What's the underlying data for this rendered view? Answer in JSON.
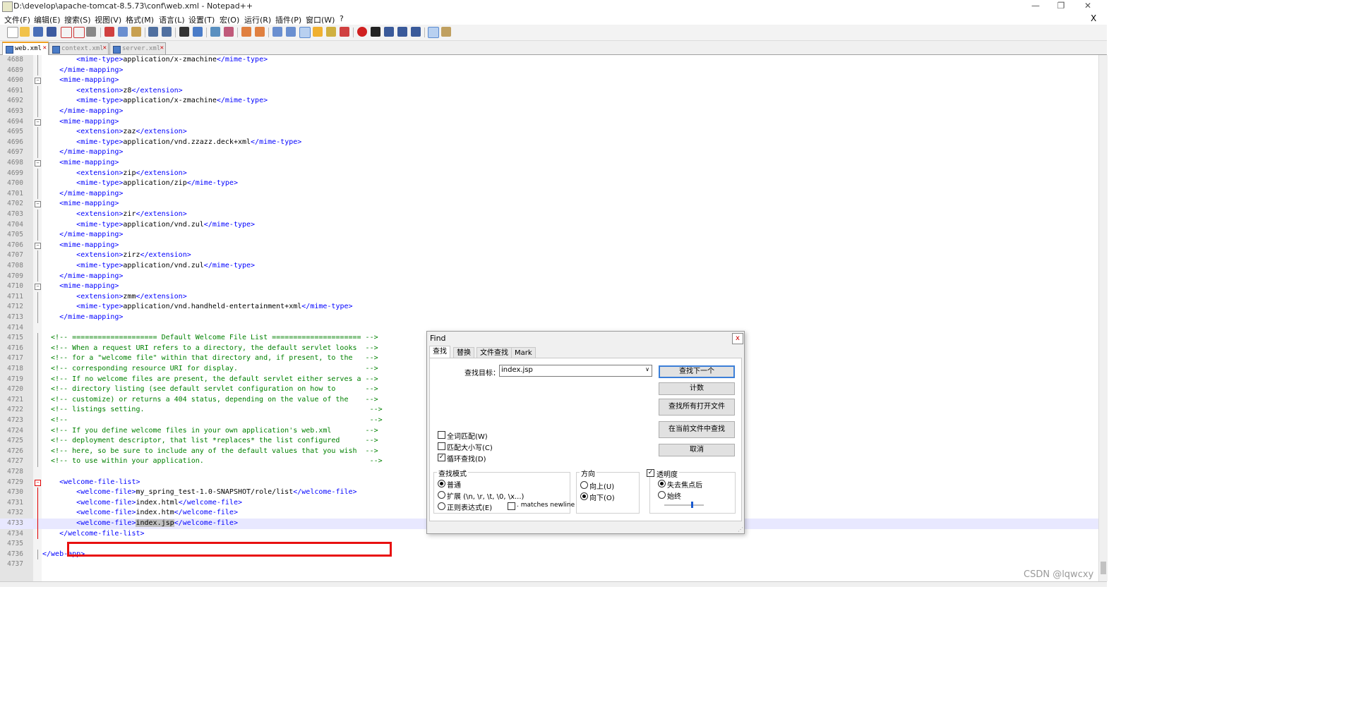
{
  "window": {
    "title": "D:\\develop\\apache-tomcat-8.5.73\\conf\\web.xml - Notepad++",
    "minimize": "—",
    "maximize": "❐",
    "close": "✕",
    "doc_close": "X"
  },
  "menu": [
    "文件(F)",
    "编辑(E)",
    "搜索(S)",
    "视图(V)",
    "格式(M)",
    "语言(L)",
    "设置(T)",
    "宏(O)",
    "运行(R)",
    "插件(P)",
    "窗口(W)",
    "?"
  ],
  "tabs": [
    {
      "label": "web.xml",
      "active": true
    },
    {
      "label": "context.xml",
      "active": false
    },
    {
      "label": "server.xml",
      "active": false
    }
  ],
  "lines": [
    {
      "n": "4688",
      "t": "        <mime-type>application/x-zmachine</mime-type>"
    },
    {
      "n": "4689",
      "t": "    </mime-mapping>"
    },
    {
      "n": "4690",
      "t": "    <mime-mapping>"
    },
    {
      "n": "4691",
      "t": "        <extension>z8</extension>"
    },
    {
      "n": "4692",
      "t": "        <mime-type>application/x-zmachine</mime-type>"
    },
    {
      "n": "4693",
      "t": "    </mime-mapping>"
    },
    {
      "n": "4694",
      "t": "    <mime-mapping>"
    },
    {
      "n": "4695",
      "t": "        <extension>zaz</extension>"
    },
    {
      "n": "4696",
      "t": "        <mime-type>application/vnd.zzazz.deck+xml</mime-type>"
    },
    {
      "n": "4697",
      "t": "    </mime-mapping>"
    },
    {
      "n": "4698",
      "t": "    <mime-mapping>"
    },
    {
      "n": "4699",
      "t": "        <extension>zip</extension>"
    },
    {
      "n": "4700",
      "t": "        <mime-type>application/zip</mime-type>"
    },
    {
      "n": "4701",
      "t": "    </mime-mapping>"
    },
    {
      "n": "4702",
      "t": "    <mime-mapping>"
    },
    {
      "n": "4703",
      "t": "        <extension>zir</extension>"
    },
    {
      "n": "4704",
      "t": "        <mime-type>application/vnd.zul</mime-type>"
    },
    {
      "n": "4705",
      "t": "    </mime-mapping>"
    },
    {
      "n": "4706",
      "t": "    <mime-mapping>"
    },
    {
      "n": "4707",
      "t": "        <extension>zirz</extension>"
    },
    {
      "n": "4708",
      "t": "        <mime-type>application/vnd.zul</mime-type>"
    },
    {
      "n": "4709",
      "t": "    </mime-mapping>"
    },
    {
      "n": "4710",
      "t": "    <mime-mapping>"
    },
    {
      "n": "4711",
      "t": "        <extension>zmm</extension>"
    },
    {
      "n": "4712",
      "t": "        <mime-type>application/vnd.handheld-entertainment+xml</mime-type>"
    },
    {
      "n": "4713",
      "t": "    </mime-mapping>"
    },
    {
      "n": "4714",
      "t": ""
    },
    {
      "n": "4715",
      "t": "  <!-- ==================== Default Welcome File List ===================== -->"
    },
    {
      "n": "4716",
      "t": "  <!-- When a request URI refers to a directory, the default servlet looks  -->"
    },
    {
      "n": "4717",
      "t": "  <!-- for a \"welcome file\" within that directory and, if present, to the   -->"
    },
    {
      "n": "4718",
      "t": "  <!-- corresponding resource URI for display.                              -->"
    },
    {
      "n": "4719",
      "t": "  <!-- If no welcome files are present, the default servlet either serves a -->"
    },
    {
      "n": "4720",
      "t": "  <!-- directory listing (see default servlet configuration on how to       -->"
    },
    {
      "n": "4721",
      "t": "  <!-- customize) or returns a 404 status, depending on the value of the    -->"
    },
    {
      "n": "4722",
      "t": "  <!-- listings setting.                                                     -->"
    },
    {
      "n": "4723",
      "t": "  <!--                                                                       -->"
    },
    {
      "n": "4724",
      "t": "  <!-- If you define welcome files in your own application's web.xml        -->"
    },
    {
      "n": "4725",
      "t": "  <!-- deployment descriptor, that list *replaces* the list configured      -->"
    },
    {
      "n": "4726",
      "t": "  <!-- here, so be sure to include any of the default values that you wish  -->"
    },
    {
      "n": "4727",
      "t": "  <!-- to use within your application.                                       -->"
    },
    {
      "n": "4728",
      "t": ""
    },
    {
      "n": "4729",
      "t": "    <welcome-file-list>"
    },
    {
      "n": "4730",
      "t": "        <welcome-file>my_spring_test-1.0-SNAPSHOT/role/list</welcome-file>"
    },
    {
      "n": "4731",
      "t": "        <welcome-file>index.html</welcome-file>"
    },
    {
      "n": "4732",
      "t": "        <welcome-file>index.htm</welcome-file>"
    },
    {
      "n": "4733",
      "t": "        <welcome-file>index.jsp</welcome-file>"
    },
    {
      "n": "4734",
      "t": "    </welcome-file-list>"
    },
    {
      "n": "4735",
      "t": ""
    },
    {
      "n": "4736",
      "t": "</web-app>"
    },
    {
      "n": "4737",
      "t": ""
    }
  ],
  "find_dialog": {
    "title": "Find",
    "close": "x",
    "tabs": [
      "查找",
      "替换",
      "文件查找",
      "Mark"
    ],
    "find_label": "查找目标：",
    "find_value": "index.jsp",
    "buttons": {
      "find_next": "查找下一个",
      "count": "计数",
      "find_all_open": "查找所有打开文件",
      "find_in_current": "在当前文件中查找",
      "cancel": "取消"
    },
    "options": {
      "whole_word": "全词匹配(W)",
      "match_case": "匹配大小写(C)",
      "wrap": "循环查找(D)"
    },
    "search_mode": {
      "title": "查找模式",
      "normal": "普通",
      "extended": "扩展 (\\n, \\r, \\t, \\0, \\x...)",
      "regex": "正则表达式(E)",
      "matches_newline": ". matches newline"
    },
    "direction": {
      "title": "方向",
      "up": "向上(U)",
      "down": "向下(O)"
    },
    "transparency": {
      "title": "透明度",
      "on_lose_focus": "失去焦点后",
      "always": "始终"
    }
  },
  "watermark": "CSDN @lqwcxy",
  "colors": {
    "tag": "#0000ff",
    "comment": "#008000",
    "highlight_box": "#e81010",
    "current_line": "#e8e8ff"
  }
}
